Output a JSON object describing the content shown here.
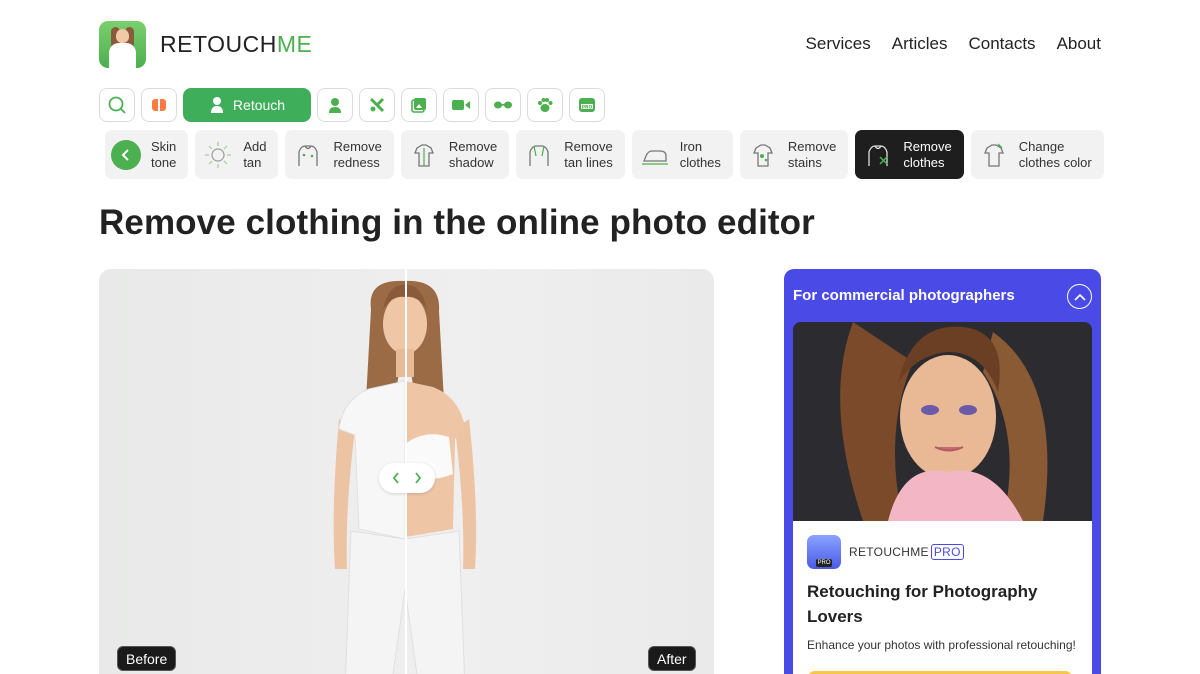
{
  "header": {
    "brand_main": "RETOUCH",
    "brand_accent": "ME",
    "nav": [
      "Services",
      "Articles",
      "Contacts",
      "About"
    ]
  },
  "category_row": {
    "active_label": "Retouch",
    "icons": [
      "search-icon",
      "face-icon",
      "retouch-icon",
      "portrait-icon",
      "tools-icon",
      "gallery-icon",
      "video-icon",
      "glasses-icon",
      "paw-icon",
      "pro-icon"
    ]
  },
  "tools": [
    {
      "line1": "Skin",
      "line2": "tone",
      "icon": "back-arrow-icon"
    },
    {
      "line1": "Add",
      "line2": "tan",
      "icon": "sun-icon"
    },
    {
      "line1": "Remove",
      "line2": "redness",
      "icon": "redness-icon"
    },
    {
      "line1": "Remove",
      "line2": "shadow",
      "icon": "shadow-icon"
    },
    {
      "line1": "Remove",
      "line2": "tan lines",
      "icon": "tan-lines-icon"
    },
    {
      "line1": "Iron",
      "line2": "clothes",
      "icon": "iron-icon"
    },
    {
      "line1": "Remove",
      "line2": "stains",
      "icon": "stains-icon"
    },
    {
      "line1": "Remove",
      "line2": "clothes",
      "icon": "remove-clothes-icon",
      "selected": true
    },
    {
      "line1": "Change",
      "line2": "clothes color",
      "icon": "clothes-color-icon"
    }
  ],
  "page": {
    "title": "Remove clothing in the online photo editor"
  },
  "compare": {
    "before_label": "Before",
    "after_label": "After"
  },
  "promo": {
    "heading": "For commercial photographers",
    "brand": "RETOUCHME",
    "brand_badge": "PRO",
    "logo_badge": "PRO",
    "title": "Retouching for Photography Lovers",
    "text": "Enhance your photos with professional retouching!",
    "accent_color": "#4a4ae6"
  },
  "colors": {
    "brand_green": "#4caf50",
    "active_green": "#3fae5a",
    "dark_tool": "#1e1e1e"
  }
}
